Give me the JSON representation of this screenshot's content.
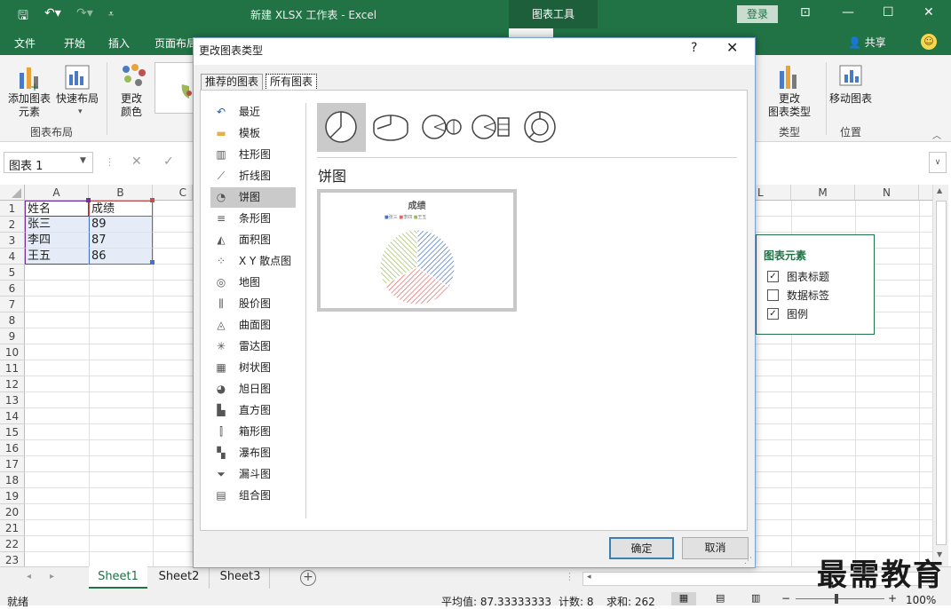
{
  "app": {
    "title": "新建 XLSX 工作表 - Excel",
    "context_tab": "图表工具",
    "login": "登录"
  },
  "menu": [
    "文件",
    "开始",
    "插入",
    "页面布局"
  ],
  "share": "共享",
  "ribbon": {
    "add_element": "添加图表\n元素",
    "quick_layout": "快速布局",
    "change_color": "更改\n颜色",
    "group_layout": "图表布局",
    "change_type": "更改\n图表类型",
    "move_chart": "移动图表",
    "group_type": "类型",
    "group_position": "位置"
  },
  "namebox": "图表 1",
  "columns": [
    "A",
    "B",
    "C",
    "L",
    "M",
    "N"
  ],
  "rows": [
    "1",
    "2",
    "3",
    "4",
    "5",
    "6",
    "7",
    "8",
    "9",
    "10",
    "11",
    "12",
    "13",
    "14",
    "15",
    "16",
    "17",
    "18",
    "19",
    "20",
    "21",
    "22",
    "23"
  ],
  "cells": [
    [
      "姓名",
      "成绩"
    ],
    [
      "张三",
      "89"
    ],
    [
      "李四",
      "87"
    ],
    [
      "王五",
      "86"
    ]
  ],
  "sheets": [
    "Sheet1",
    "Sheet2",
    "Sheet3"
  ],
  "status": {
    "ready": "就绪",
    "average": "平均值: 87.33333333",
    "count": "计数: 8",
    "sum": "求和: 262",
    "zoom": "100%"
  },
  "dialog": {
    "title": "更改图表类型",
    "help": "?",
    "tabs": [
      "推荐的图表",
      "所有图表"
    ],
    "chart_types": [
      "最近",
      "模板",
      "柱形图",
      "折线图",
      "饼图",
      "条形图",
      "面积图",
      "X Y 散点图",
      "地图",
      "股价图",
      "曲面图",
      "雷达图",
      "树状图",
      "旭日图",
      "直方图",
      "箱形图",
      "瀑布图",
      "漏斗图",
      "组合图"
    ],
    "selected_type": "饼图",
    "ok": "确定",
    "cancel": "取消"
  },
  "preview": {
    "title": "成绩",
    "legend": [
      "张三",
      "李四",
      "王五"
    ]
  },
  "chart_data": {
    "type": "pie",
    "title": "成绩",
    "categories": [
      "张三",
      "李四",
      "王五"
    ],
    "values": [
      89,
      87,
      86
    ],
    "colors": [
      "#4472c4",
      "#e06666",
      "#9bbb59"
    ],
    "legend": "top"
  },
  "chart_elements": {
    "title": "图表元素",
    "items": [
      {
        "label": "图表标题",
        "checked": true
      },
      {
        "label": "数据标签",
        "checked": false
      },
      {
        "label": "图例",
        "checked": true
      }
    ]
  },
  "watermark": "最需教育"
}
